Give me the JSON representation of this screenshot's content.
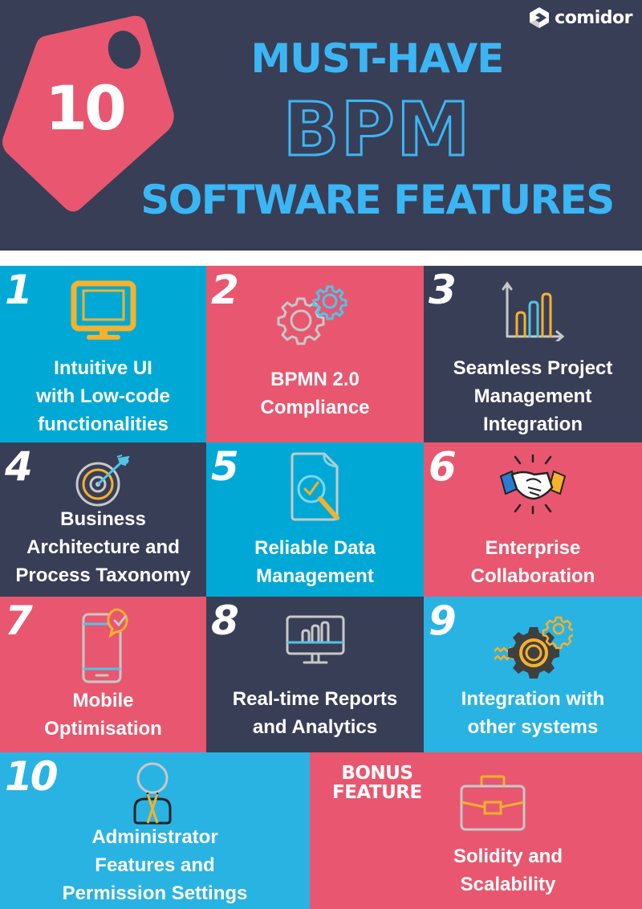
{
  "header": {
    "badge_number": "10",
    "title_line1": "MUST-HAVE",
    "title_line2": "BPM",
    "title_line3": "SOFTWARE FEATURES",
    "brand": "comidor"
  },
  "colors": {
    "navy": "#383e56",
    "pink": "#e8576f",
    "blue": "#00a9d5",
    "light_blue": "#29b3e2",
    "title_blue": "#3bb6f5",
    "accent_yellow": "#f6b12d",
    "icon_grey": "#c8c8c8"
  },
  "features": [
    {
      "number": "1",
      "label_lines": [
        "Intuitive UI",
        "with Low-code",
        "functionalities"
      ],
      "icon": "monitor-icon"
    },
    {
      "number": "2",
      "label_lines": [
        "BPMN 2.0",
        "Compliance"
      ],
      "icon": "gears-icon"
    },
    {
      "number": "3",
      "label_lines": [
        "Seamless Project",
        "Management",
        "Integration"
      ],
      "icon": "bar-chart-icon"
    },
    {
      "number": "4",
      "label_lines": [
        "Business",
        "Architecture and",
        "Process Taxonomy"
      ],
      "icon": "target-icon"
    },
    {
      "number": "5",
      "label_lines": [
        "Reliable Data",
        "Management"
      ],
      "icon": "document-search-icon"
    },
    {
      "number": "6",
      "label_lines": [
        "Enterprise",
        "Collaboration"
      ],
      "icon": "handshake-icon"
    },
    {
      "number": "7",
      "label_lines": [
        "Mobile",
        "Optimisation"
      ],
      "icon": "mobile-check-icon"
    },
    {
      "number": "8",
      "label_lines": [
        "Real-time Reports",
        "and Analytics"
      ],
      "icon": "monitor-chart-icon"
    },
    {
      "number": "9",
      "label_lines": [
        "Integration with",
        "other systems"
      ],
      "icon": "gear-integration-icon"
    },
    {
      "number": "10",
      "label_lines": [
        "Administrator",
        "Features and",
        "Permission Settings"
      ],
      "icon": "administrator-icon"
    }
  ],
  "bonus": {
    "title_lines": [
      "BONUS",
      "FEATURE"
    ],
    "label_lines": [
      "Solidity and",
      "Scalability"
    ],
    "icon": "briefcase-icon"
  }
}
